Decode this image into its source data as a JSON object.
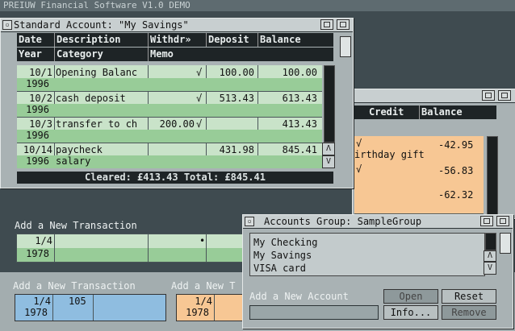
{
  "screen": {
    "title": "PREIUW Financial Software V1.0 DEMO"
  },
  "account_window": {
    "title": "Standard Account: \"My Savings\"",
    "columns_line1": [
      "Date",
      "Description",
      "Withdr»",
      "Deposit",
      "Balance"
    ],
    "columns_line2": [
      "Year",
      "Category",
      "Memo"
    ],
    "rows": [
      {
        "date": "10/1",
        "year": "1996",
        "description": "Opening Balanc",
        "category": "",
        "withdrawal": "",
        "check": "√",
        "deposit": "100.00",
        "balance": "100.00"
      },
      {
        "date": "10/2",
        "year": "1996",
        "description": "cash deposit",
        "category": "",
        "withdrawal": "",
        "check": "√",
        "deposit": "513.43",
        "balance": "613.43"
      },
      {
        "date": "10/3",
        "year": "1996",
        "description": "transfer to ch",
        "category": "",
        "withdrawal": "200.00",
        "check": "√",
        "deposit": "",
        "balance": "413.43"
      },
      {
        "date": "10/14",
        "year": "1996",
        "description": "paycheck",
        "category": "salary",
        "withdrawal": "",
        "check": "",
        "deposit": "431.98",
        "balance": "845.41"
      }
    ],
    "totals": "Cleared: £413.43   Total: £845.41",
    "scroll_up": "Λ",
    "scroll_down": "V"
  },
  "new_transaction_1": {
    "label": "Add a New Transaction",
    "date": "1/4",
    "year": "1978",
    "dot": "•"
  },
  "new_transaction_2": {
    "label": "Add a New Transaction",
    "date": "1/4",
    "year": "1978",
    "num": "105"
  },
  "new_transaction_3": {
    "label": "Add a New T",
    "date": "1/4",
    "year": "1978"
  },
  "credit_window": {
    "columns": [
      "Credit",
      "Balance"
    ],
    "rows": [
      {
        "memo": "irthday gift",
        "check": "√",
        "balance": "-42.95"
      },
      {
        "memo": "",
        "check": "√",
        "balance": "-56.83"
      },
      {
        "memo": "",
        "check": "",
        "balance": "-62.32"
      }
    ]
  },
  "group_window": {
    "title": "Accounts Group: SampleGroup",
    "accounts": [
      "My Checking",
      "My Savings",
      "VISA card"
    ],
    "add_label": "Add a New Account",
    "buttons": {
      "open": "Open",
      "reset": "Reset",
      "info": "Info...",
      "remove": "Remove"
    },
    "scroll_up": "Λ",
    "scroll_down": "V"
  },
  "colors": {
    "accent_green": "#98cc98",
    "accent_orange": "#f7c794",
    "accent_blue": "#8fbde0"
  }
}
